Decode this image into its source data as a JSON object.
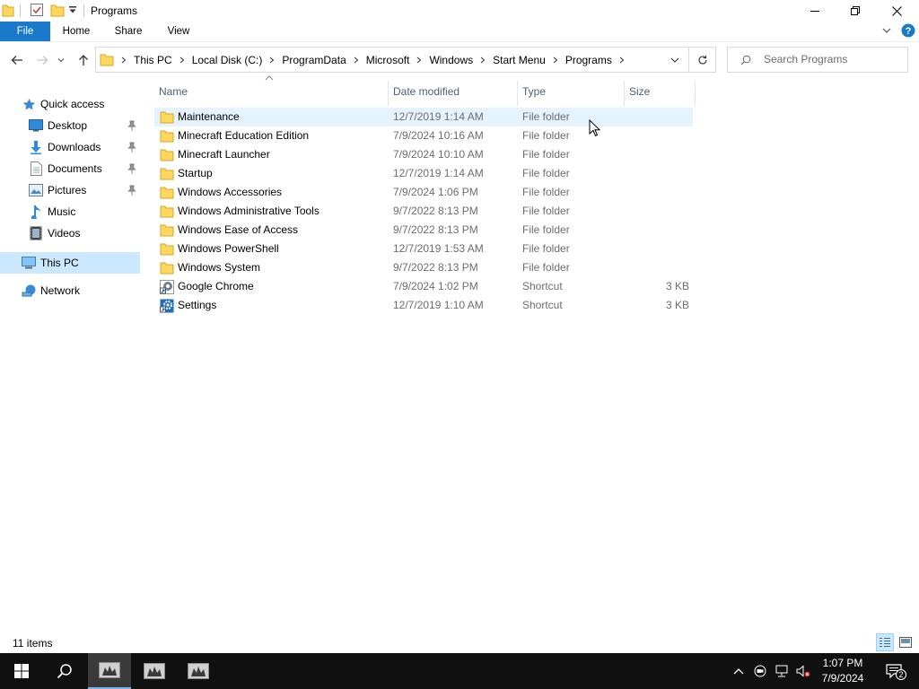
{
  "window": {
    "title": "Programs"
  },
  "ribbon": {
    "tabs": [
      "File",
      "Home",
      "Share",
      "View"
    ]
  },
  "address": {
    "crumbs": [
      "This PC",
      "Local Disk (C:)",
      "ProgramData",
      "Microsoft",
      "Windows",
      "Start Menu",
      "Programs"
    ]
  },
  "search": {
    "placeholder": "Search Programs"
  },
  "nav_pane": {
    "quick_access": "Quick access",
    "pinned": [
      {
        "label": "Desktop",
        "icon": "desktop-icon"
      },
      {
        "label": "Downloads",
        "icon": "downloads-icon"
      },
      {
        "label": "Documents",
        "icon": "documents-icon"
      },
      {
        "label": "Pictures",
        "icon": "pictures-icon"
      }
    ],
    "unpinned": [
      {
        "label": "Music",
        "icon": "music-icon"
      },
      {
        "label": "Videos",
        "icon": "videos-icon"
      }
    ],
    "this_pc": "This PC",
    "network": "Network"
  },
  "columns": {
    "name": "Name",
    "date": "Date modified",
    "type": "Type",
    "size": "Size"
  },
  "files": [
    {
      "name": "Maintenance",
      "date": "12/7/2019 1:14 AM",
      "type": "File folder",
      "size": "",
      "icon": "folder-icon"
    },
    {
      "name": "Minecraft Education Edition",
      "date": "7/9/2024 10:16 AM",
      "type": "File folder",
      "size": "",
      "icon": "folder-icon"
    },
    {
      "name": "Minecraft Launcher",
      "date": "7/9/2024 10:10 AM",
      "type": "File folder",
      "size": "",
      "icon": "folder-icon"
    },
    {
      "name": "Startup",
      "date": "12/7/2019 1:14 AM",
      "type": "File folder",
      "size": "",
      "icon": "folder-icon"
    },
    {
      "name": "Windows Accessories",
      "date": "7/9/2024 1:06 PM",
      "type": "File folder",
      "size": "",
      "icon": "folder-icon"
    },
    {
      "name": "Windows Administrative Tools",
      "date": "9/7/2022 8:13 PM",
      "type": "File folder",
      "size": "",
      "icon": "folder-icon"
    },
    {
      "name": "Windows Ease of Access",
      "date": "9/7/2022 8:13 PM",
      "type": "File folder",
      "size": "",
      "icon": "folder-icon"
    },
    {
      "name": "Windows PowerShell",
      "date": "12/7/2019 1:53 AM",
      "type": "File folder",
      "size": "",
      "icon": "folder-icon"
    },
    {
      "name": "Windows System",
      "date": "9/7/2022 8:13 PM",
      "type": "File folder",
      "size": "",
      "icon": "folder-icon"
    },
    {
      "name": "Google Chrome",
      "date": "7/9/2024 1:02 PM",
      "type": "Shortcut",
      "size": "3 KB",
      "icon": "chrome-shortcut-icon"
    },
    {
      "name": "Settings",
      "date": "12/7/2019 1:10 AM",
      "type": "Shortcut",
      "size": "3 KB",
      "icon": "settings-shortcut-icon"
    }
  ],
  "status": {
    "item_count": "11 items"
  },
  "taskbar": {
    "time": "1:07 PM",
    "date": "7/9/2024",
    "notification_count": "2"
  },
  "colors": {
    "accent": "#1979ca",
    "hover_row": "#e5f3ff",
    "selected_nav": "#cce8ff",
    "folder": "#ffd75e",
    "taskbar": "#101010"
  }
}
